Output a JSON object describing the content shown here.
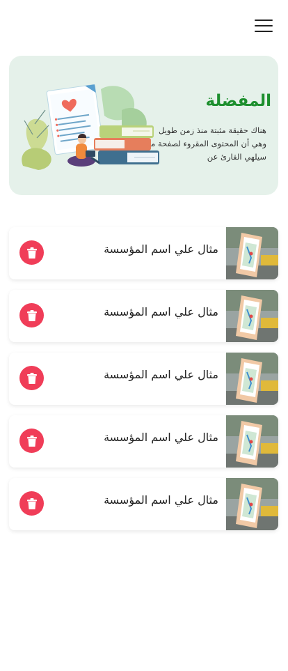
{
  "header": {
    "menu_icon": "hamburger-menu-icon"
  },
  "hero": {
    "title": "المفضلة",
    "description": "هناك حقيقة مثبتة منذ زمن طويل وهي أن المحتوى المقروء لصفحة ما سيلهي القارئ عن",
    "background_color": "#e5f1ea",
    "title_color": "#1d8f2e",
    "illustration": "favorites-books-illustration"
  },
  "favorites": [
    {
      "title": "مثال علي اسم المؤسسة",
      "thumbnail": "phone-map-street-thumbnail",
      "delete_icon": "trash-icon"
    },
    {
      "title": "مثال علي اسم المؤسسة",
      "thumbnail": "phone-map-street-thumbnail",
      "delete_icon": "trash-icon"
    },
    {
      "title": "مثال علي اسم المؤسسة",
      "thumbnail": "phone-map-street-thumbnail",
      "delete_icon": "trash-icon"
    },
    {
      "title": "مثال علي اسم المؤسسة",
      "thumbnail": "phone-map-street-thumbnail",
      "delete_icon": "trash-icon"
    },
    {
      "title": "مثال علي اسم المؤسسة",
      "thumbnail": "phone-map-street-thumbnail",
      "delete_icon": "trash-icon"
    }
  ],
  "colors": {
    "delete_button": "#f03d58",
    "accent": "#1d8f2e"
  }
}
